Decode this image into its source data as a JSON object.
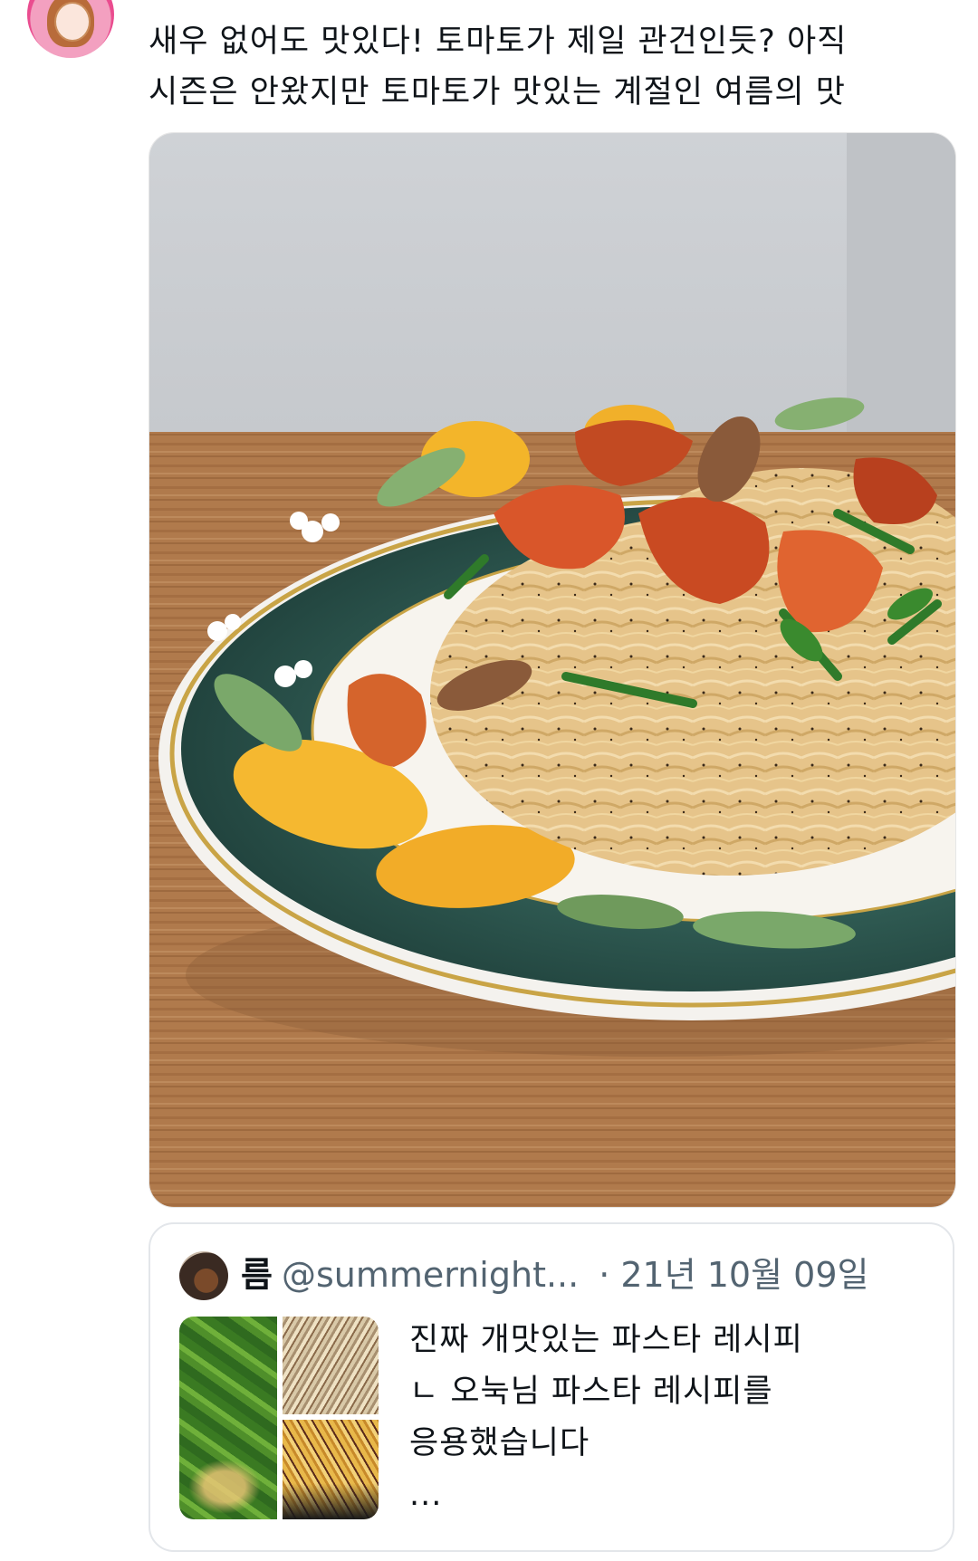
{
  "tweet": {
    "text_lines": [
      "새우 없어도 맛있다! 토마토가 제일 관건인듯? 아직",
      "시즌은 안왔지만 토마토가 맛있는 계절인 여름의 맛"
    ],
    "media_description_icon": "pasta-photo"
  },
  "quote": {
    "name": "름",
    "handle": "@summernight...",
    "date": "· 21년 10월 09일",
    "text_lines": [
      "진짜 개맛있는 파스타 레시피",
      "ㄴ 오눅님 파스타 레시피를",
      "응용했습니다",
      "..."
    ]
  }
}
